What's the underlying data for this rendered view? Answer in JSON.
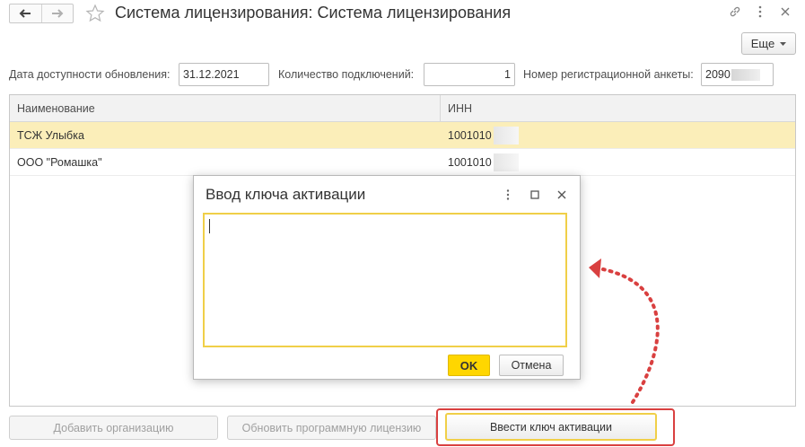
{
  "window": {
    "title": "Система лицензирования: Система лицензирования",
    "more_label": "Еще"
  },
  "form": {
    "update_date_label": "Дата доступности обновления:",
    "update_date_value": "31.12.2021",
    "connections_label": "Количество подключений:",
    "connections_value": "1",
    "reg_number_label": "Номер регистрационной анкеты:",
    "reg_number_value": "2090"
  },
  "table": {
    "columns": [
      "Наименование",
      "ИНН"
    ],
    "rows": [
      {
        "name": "ТСЖ Улыбка",
        "inn": "1001010"
      },
      {
        "name": "ООО \"Ромашка\"",
        "inn": "1001010"
      }
    ]
  },
  "buttons": {
    "add_org": "Добавить организацию",
    "update_license": "Обновить программную лицензию",
    "enter_key": "Ввести ключ активации"
  },
  "dialog": {
    "title": "Ввод ключа активации",
    "text_value": "",
    "ok_label": "OK",
    "cancel_label": "Отмена"
  },
  "colors": {
    "accent_yellow": "#ffd600",
    "focus_border": "#f0cf48",
    "selected_row": "#fbeeb9",
    "annotation_red": "#d94040"
  },
  "icons": {
    "back": "arrow-left-icon",
    "forward": "arrow-right-icon",
    "favorite": "star-icon",
    "link": "link-icon",
    "menu": "kebab-menu-icon",
    "close": "close-icon",
    "maximize": "maximize-icon"
  }
}
